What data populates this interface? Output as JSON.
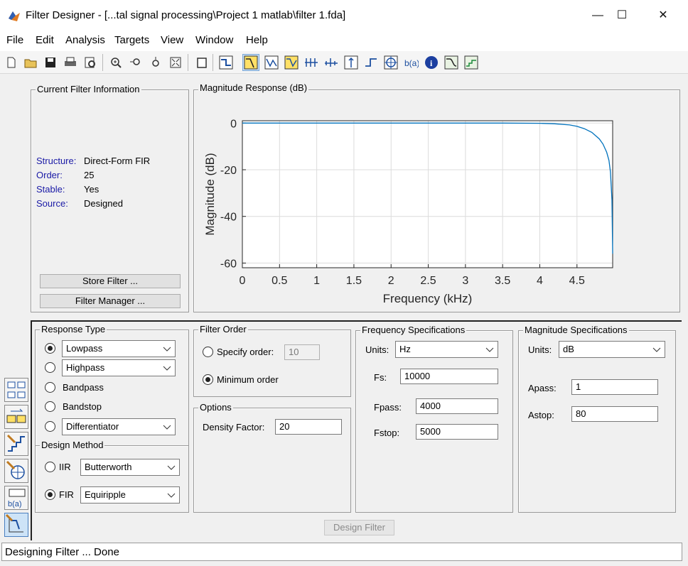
{
  "window": {
    "title": "Filter Designer -  [...tal signal processing\\Project 1 matlab\\filter 1.fda]",
    "minimize": "—",
    "maximize": "☐",
    "close": "✕"
  },
  "menu": [
    "File",
    "Edit",
    "Analysis",
    "Targets",
    "View",
    "Window",
    "Help"
  ],
  "toolbar_icons": [
    "new-icon",
    "open-icon",
    "save-icon",
    "print-icon",
    "print-preview-icon",
    "zoom-in-icon",
    "zoom-x-icon",
    "zoom-y-icon",
    "full-view-icon",
    "new-window-icon",
    "filter-spec-icon",
    "magnitude-response-icon",
    "phase-response-icon",
    "mag-phase-icon",
    "group-delay-icon",
    "phase-delay-icon",
    "impulse-response-icon",
    "step-response-icon",
    "pole-zero-icon",
    "coefficients-icon",
    "info-icon",
    "cost-icon",
    "quantization-icon"
  ],
  "current_filter_info": {
    "legend": "Current Filter Information",
    "rows": [
      {
        "key": "Structure:",
        "value": "Direct-Form FIR"
      },
      {
        "key": "Order:",
        "value": "25"
      },
      {
        "key": "Stable:",
        "value": "Yes"
      },
      {
        "key": "Source:",
        "value": "Designed"
      }
    ],
    "store_button": "Store Filter ...",
    "manager_button": "Filter Manager ..."
  },
  "magnitude_panel": {
    "legend": "Magnitude Response (dB)"
  },
  "chart_data": {
    "type": "line",
    "title": "",
    "xlabel": "Frequency (kHz)",
    "ylabel": "Magnitude (dB)",
    "xlim": [
      0,
      4.98
    ],
    "ylim": [
      -62,
      1
    ],
    "xticks": [
      0,
      0.5,
      1,
      1.5,
      2,
      2.5,
      3,
      3.5,
      4,
      4.5
    ],
    "xtick_labels": [
      "0",
      "0.5",
      "1",
      "1.5",
      "2",
      "2.5",
      "3",
      "3.5",
      "4",
      "4.5"
    ],
    "yticks": [
      0,
      -20,
      -40,
      -60
    ],
    "ytick_labels": [
      "0",
      "-20",
      "-40",
      "-60"
    ],
    "grid": true,
    "color": "#0072bd",
    "series": [
      {
        "x": [
          0,
          0.5,
          1,
          1.5,
          2,
          2.5,
          3,
          3.5,
          4,
          4.2,
          4.4,
          4.5,
          4.6,
          4.7,
          4.8,
          4.85,
          4.9,
          4.93,
          4.95,
          4.97,
          4.98
        ],
        "y": [
          0,
          0,
          0,
          0,
          0,
          0,
          0,
          0,
          -0.1,
          -0.3,
          -0.8,
          -1.4,
          -2.4,
          -4.0,
          -6.8,
          -9.0,
          -12.5,
          -16.0,
          -21.0,
          -33.0,
          -56.0
        ]
      }
    ]
  },
  "response_type": {
    "legend": "Response Type",
    "options": [
      {
        "label": "Lowpass",
        "selected": true,
        "kind": "select"
      },
      {
        "label": "Highpass",
        "selected": false,
        "kind": "select"
      },
      {
        "label": "Bandpass",
        "selected": false,
        "kind": "text"
      },
      {
        "label": "Bandstop",
        "selected": false,
        "kind": "text"
      },
      {
        "label": "Differentiator",
        "selected": false,
        "kind": "select"
      }
    ]
  },
  "design_method": {
    "legend": "Design Method",
    "iir_label": "IIR",
    "iir_value": "Butterworth",
    "fir_label": "FIR",
    "fir_value": "Equiripple",
    "selected": "FIR"
  },
  "filter_order": {
    "legend": "Filter Order",
    "specify_label": "Specify order:",
    "specify_value": "10",
    "minimum_label": "Minimum order",
    "selected": "minimum"
  },
  "options": {
    "legend": "Options",
    "density_label": "Density Factor:",
    "density_value": "20"
  },
  "frequency_specs": {
    "legend": "Frequency Specifications",
    "units_label": "Units:",
    "units_value": "Hz",
    "fs_label": "Fs:",
    "fs_value": "10000",
    "fpass_label": "Fpass:",
    "fpass_value": "4000",
    "fstop_label": "Fstop:",
    "fstop_value": "5000"
  },
  "magnitude_specs": {
    "legend": "Magnitude Specifications",
    "units_label": "Units:",
    "units_value": "dB",
    "apass_label": "Apass:",
    "apass_value": "1",
    "astop_label": "Astop:",
    "astop_value": "80"
  },
  "design_button": "Design Filter",
  "status": "Designing Filter ... Done"
}
